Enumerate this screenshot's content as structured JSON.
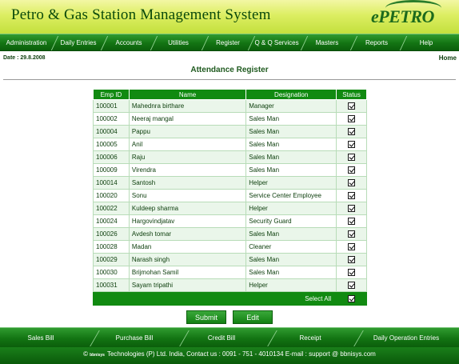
{
  "header": {
    "app_title": "Petro & Gas Station Management System",
    "logo_text": "ePETRO"
  },
  "topnav": [
    {
      "label": "Administration",
      "name": "nav-administration"
    },
    {
      "label": "Daily Entries",
      "name": "nav-daily-entries"
    },
    {
      "label": "Accounts",
      "name": "nav-accounts"
    },
    {
      "label": "Utilities",
      "name": "nav-utilities"
    },
    {
      "label": "Register",
      "name": "nav-register"
    },
    {
      "label": "Q & Q Services",
      "name": "nav-q-and-q-services"
    },
    {
      "label": "Masters",
      "name": "nav-masters"
    },
    {
      "label": "Reports",
      "name": "nav-reports"
    },
    {
      "label": "Help",
      "name": "nav-help"
    }
  ],
  "info": {
    "date": "Date : 29.8.2008",
    "home": "Home"
  },
  "page_title": "Attendance Register",
  "table": {
    "columns": [
      "Emp ID",
      "Name",
      "Designation",
      "Status"
    ],
    "rows": [
      {
        "emp_id": "100001",
        "name": "Mahednra birthare",
        "designation": "Manager",
        "checked": true
      },
      {
        "emp_id": "100002",
        "name": "Neeraj mangal",
        "designation": "Sales Man",
        "checked": true
      },
      {
        "emp_id": "100004",
        "name": "Pappu",
        "designation": "Sales Man",
        "checked": true
      },
      {
        "emp_id": "100005",
        "name": "Anil",
        "designation": "Sales Man",
        "checked": true
      },
      {
        "emp_id": "100006",
        "name": "Raju",
        "designation": "Sales Man",
        "checked": true
      },
      {
        "emp_id": "100009",
        "name": "Virendra",
        "designation": "Sales Man",
        "checked": true
      },
      {
        "emp_id": "100014",
        "name": "Santosh",
        "designation": "Helper",
        "checked": true
      },
      {
        "emp_id": "100020",
        "name": "Sonu",
        "designation": "Service Center Employee",
        "checked": true
      },
      {
        "emp_id": "100022",
        "name": "Kuldeep sharma",
        "designation": "Helper",
        "checked": true
      },
      {
        "emp_id": "100024",
        "name": "Hargovindjatav",
        "designation": "Security Guard",
        "checked": true
      },
      {
        "emp_id": "100026",
        "name": "Avdesh tomar",
        "designation": "Sales Man",
        "checked": true
      },
      {
        "emp_id": "100028",
        "name": "Madan",
        "designation": "Cleaner",
        "checked": true
      },
      {
        "emp_id": "100029",
        "name": "Narash singh",
        "designation": "Sales Man",
        "checked": true
      },
      {
        "emp_id": "100030",
        "name": "Brijmohan Samil",
        "designation": "Sales Man",
        "checked": true
      },
      {
        "emp_id": "100031",
        "name": "Sayam tripathi",
        "designation": "Helper",
        "checked": true
      }
    ],
    "select_all_label": "Select All",
    "select_all_checked": true
  },
  "buttons": {
    "submit": "Submit",
    "edit": "Edit"
  },
  "bottomnav": [
    {
      "label": "Sales Bill",
      "name": "bottom-nav-sales-bill"
    },
    {
      "label": "Purchase Bill",
      "name": "bottom-nav-purchase-bill"
    },
    {
      "label": "Credit Bill",
      "name": "bottom-nav-credit-bill"
    },
    {
      "label": "Receipt",
      "name": "bottom-nav-receipt"
    },
    {
      "label": "Daily Operation Entries",
      "name": "bottom-nav-daily-operation-entries"
    }
  ],
  "footer": {
    "copyright_symbol": "©",
    "brand": "bbnisys",
    "text": "Technologies (P) Ltd. India, Contact us : 0091 - 751 - 4010134 E-mail : support @ bbnisys.com"
  },
  "colors": {
    "nav_green": "#137413",
    "header_yellow": "#dcee62",
    "table_header": "#118a11",
    "row_alt": "#eaf6ea"
  }
}
